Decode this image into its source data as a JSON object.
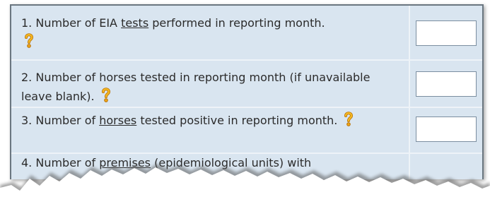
{
  "questions": [
    {
      "number": "1.",
      "before": "Number of EIA ",
      "link": "tests",
      "after": " performed in reporting month.",
      "help_icon": "question-mark-icon"
    },
    {
      "number": "2.",
      "before": "Number of horses tested in reporting month (if unavailable leave blank).",
      "link": "",
      "after": "",
      "help_icon": "question-mark-icon"
    },
    {
      "number": "3.",
      "before": "Number of ",
      "link": "horses",
      "after": " tested positive in reporting month.",
      "help_icon": "question-mark-icon"
    },
    {
      "number": "4.",
      "before": "Number of ",
      "link": "premises",
      "after": " (epidemiological units) with"
    }
  ],
  "inputs": [
    {
      "value": ""
    },
    {
      "value": ""
    },
    {
      "value": ""
    }
  ],
  "colors": {
    "panel_background": "#d9e5f0",
    "separator": "#eef3f8",
    "help_icon": "#f0a818",
    "text": "#2b2b2b"
  }
}
